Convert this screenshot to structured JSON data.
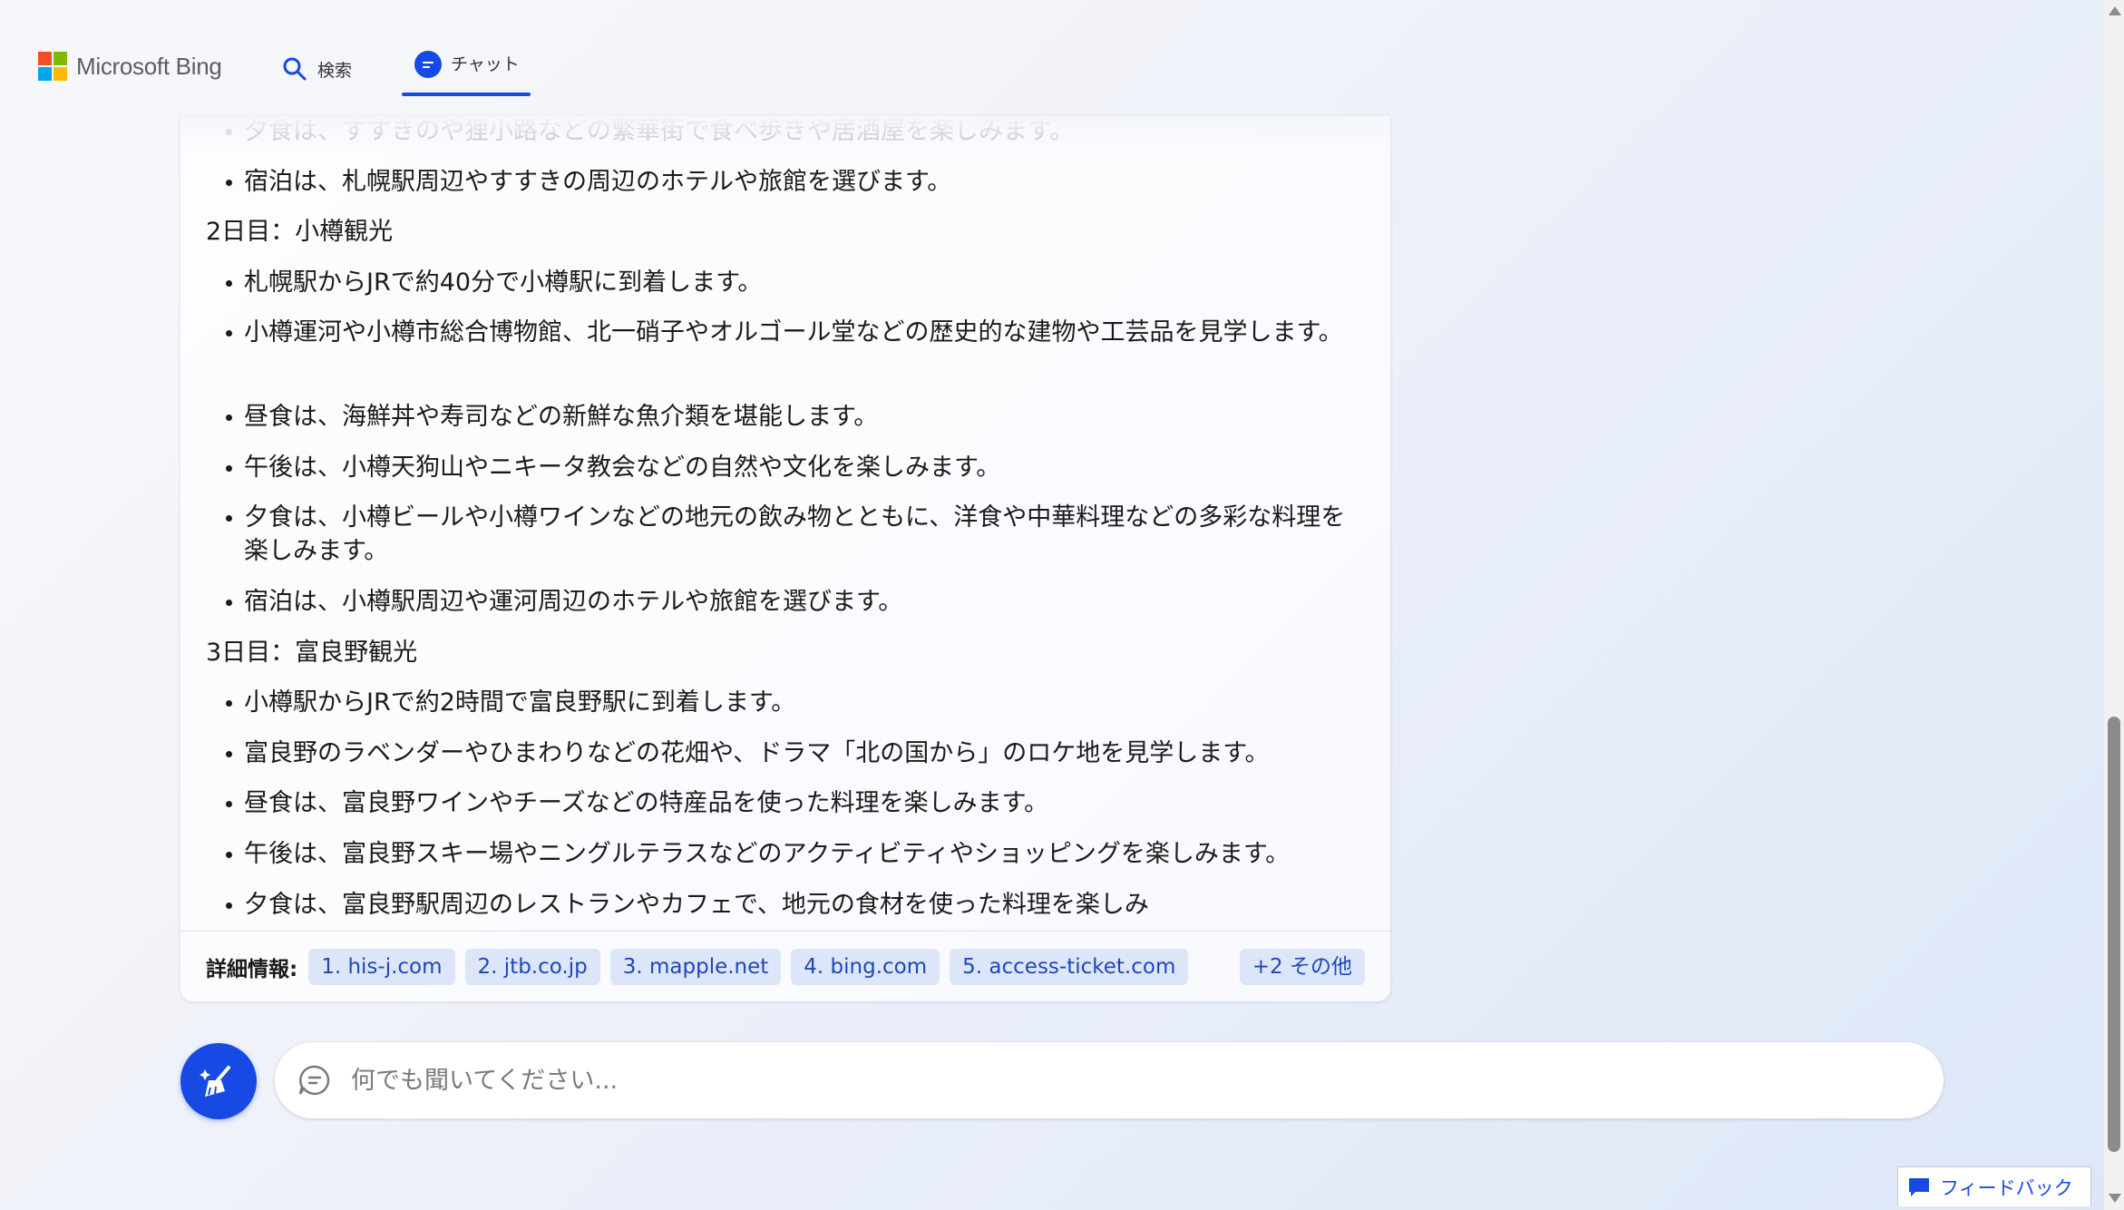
{
  "header": {
    "brand": "Microsoft Bing",
    "tabs": [
      {
        "label": "検索",
        "icon": "search-icon"
      },
      {
        "label": "チャット",
        "icon": "chat-icon",
        "active": true
      }
    ]
  },
  "chat": {
    "lines": [
      {
        "type": "bullet",
        "text": "夕食は、すすきのや狸小路などの繁華街で食べ歩きや居酒屋を楽しみます。",
        "faded": true
      },
      {
        "type": "bullet",
        "text": "宿泊は、札幌駅周辺やすすきの周辺のホテルや旅館を選びます。"
      },
      {
        "type": "heading",
        "text": "2日目：小樽観光"
      },
      {
        "type": "bullet",
        "text": "札幌駅からJRで約40分で小樽駅に到着します。"
      },
      {
        "type": "bullet",
        "text": "小樽運河や小樽市総合博物館、北一硝子やオルゴール堂などの歴史的な建物や工芸品を見学します。"
      },
      {
        "type": "bullet",
        "text": "昼食は、海鮮丼や寿司などの新鮮な魚介類を堪能します。"
      },
      {
        "type": "bullet",
        "text": "午後は、小樽天狗山やニキータ教会などの自然や文化を楽しみます。"
      },
      {
        "type": "bullet",
        "text": "夕食は、小樽ビールや小樽ワインなどの地元の飲み物とともに、洋食や中華料理などの多彩な料理を楽しみます。"
      },
      {
        "type": "bullet",
        "text": "宿泊は、小樽駅周辺や運河周辺のホテルや旅館を選びます。"
      },
      {
        "type": "heading",
        "text": "3日目：富良野観光"
      },
      {
        "type": "bullet",
        "text": "小樽駅からJRで約2時間で富良野駅に到着します。"
      },
      {
        "type": "bullet",
        "text": "富良野のラベンダーやひまわりなどの花畑や、ドラマ「北の国から」のロケ地を見学します。"
      },
      {
        "type": "bullet",
        "text": "昼食は、富良野ワインやチーズなどの特産品を使った料理を楽しみます。"
      },
      {
        "type": "bullet",
        "text": "午後は、富良野スキー場やニングルテラスなどのアクティビティやショッピングを楽しみます。"
      },
      {
        "type": "bullet",
        "text": "夕食は、富良野駅周辺のレストランやカフェで、地元の食材を使った料理を楽しみ"
      }
    ],
    "sources_label": "詳細情報:",
    "sources": [
      "1. his-j.com",
      "2. jtb.co.jp",
      "3. mapple.net",
      "4. bing.com",
      "5. access-ticket.com"
    ],
    "more_label": "+2 その他"
  },
  "input": {
    "placeholder": "何でも聞いてください..."
  },
  "feedback_label": "フィードバック",
  "colors": {
    "accent": "#174ae4",
    "chip_bg": "#dde6f9",
    "chip_text": "#1d48b8"
  }
}
